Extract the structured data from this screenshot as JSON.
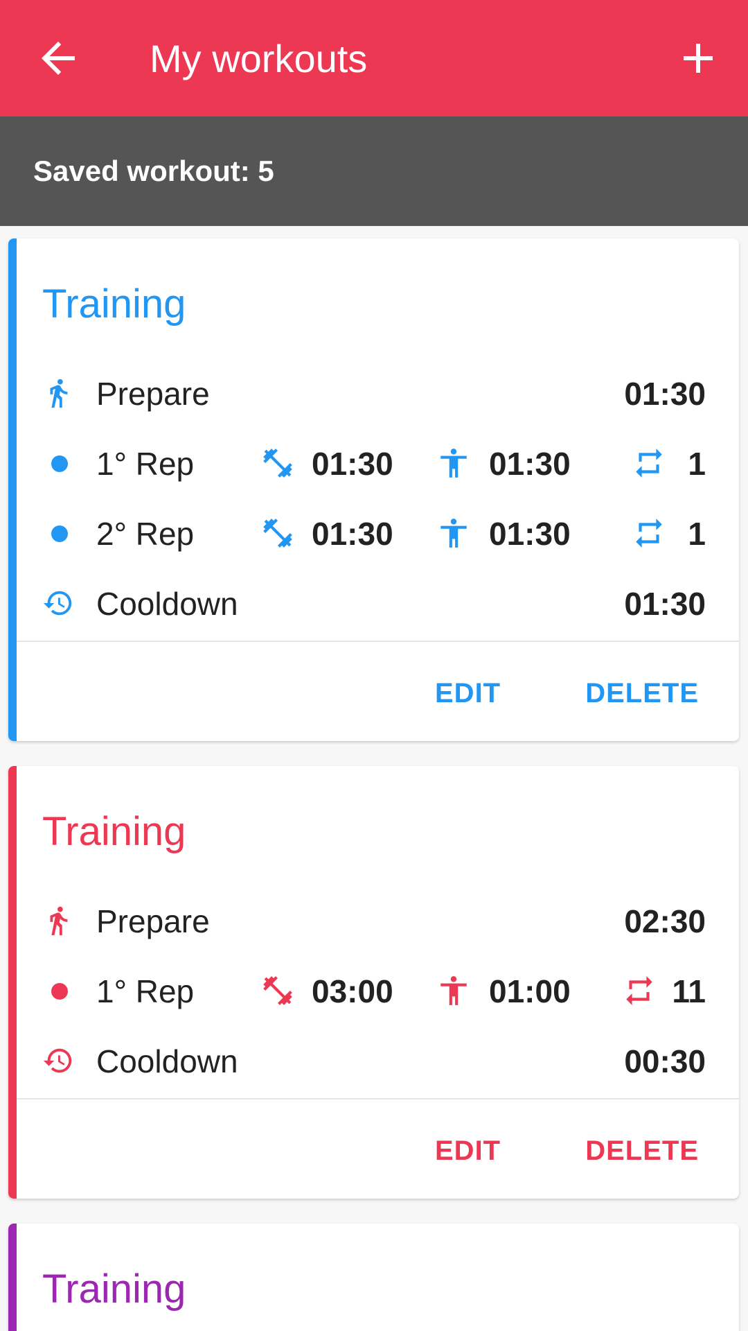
{
  "appbar": {
    "title": "My workouts",
    "back_icon": "arrow-back-icon",
    "add_icon": "add-icon"
  },
  "subbar": {
    "label": "Saved workout: 5"
  },
  "colors": {
    "primary": "#ec3853",
    "subbar": "#555555",
    "blue": "#2196f3",
    "red": "#ec3853",
    "purple": "#9c27b0"
  },
  "cards": [
    {
      "title": "Training",
      "color": "blue",
      "prepare": {
        "label": "Prepare",
        "time": "01:30"
      },
      "reps": [
        {
          "label": "1° Rep",
          "work": "01:30",
          "rest": "01:30",
          "repeat": "1"
        },
        {
          "label": "2° Rep",
          "work": "01:30",
          "rest": "01:30",
          "repeat": "1"
        }
      ],
      "cooldown": {
        "label": "Cooldown",
        "time": "01:30"
      },
      "edit_label": "EDIT",
      "delete_label": "DELETE"
    },
    {
      "title": "Training",
      "color": "red",
      "prepare": {
        "label": "Prepare",
        "time": "02:30"
      },
      "reps": [
        {
          "label": "1° Rep",
          "work": "03:00",
          "rest": "01:00",
          "repeat": "11"
        }
      ],
      "cooldown": {
        "label": "Cooldown",
        "time": "00:30"
      },
      "edit_label": "EDIT",
      "delete_label": "DELETE"
    },
    {
      "title": "Training",
      "color": "purple"
    }
  ]
}
